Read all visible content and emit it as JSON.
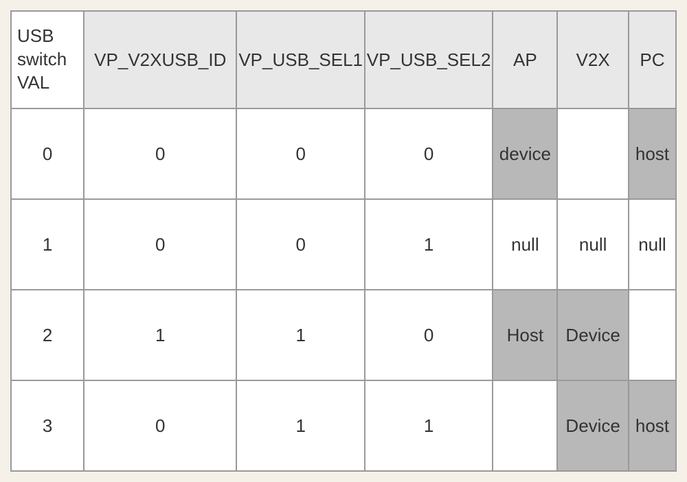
{
  "headers": {
    "col0": "USB switch VAL",
    "col1": "VP_V2XUSB_ID",
    "col2": "VP_USB_SEL1",
    "col3": "VP_USB_SEL2",
    "col4": "AP",
    "col5": "V2X",
    "col6": "PC"
  },
  "rows": [
    {
      "val": "0",
      "id": "0",
      "sel1": "0",
      "sel2": "0",
      "ap": "device",
      "v2x": "",
      "pc": "host",
      "shaded": {
        "ap": true,
        "v2x": false,
        "pc": true
      }
    },
    {
      "val": "1",
      "id": "0",
      "sel1": "0",
      "sel2": "1",
      "ap": "null",
      "v2x": "null",
      "pc": "null",
      "shaded": {
        "ap": false,
        "v2x": false,
        "pc": false
      }
    },
    {
      "val": "2",
      "id": "1",
      "sel1": "1",
      "sel2": "0",
      "ap": "Host",
      "v2x": "Device",
      "pc": "",
      "shaded": {
        "ap": true,
        "v2x": true,
        "pc": false
      }
    },
    {
      "val": "3",
      "id": "0",
      "sel1": "1",
      "sel2": "1",
      "ap": "",
      "v2x": "Device",
      "pc": "host",
      "shaded": {
        "ap": false,
        "v2x": true,
        "pc": true
      }
    }
  ],
  "chart_data": {
    "type": "table",
    "title": "USB switch VAL configuration table",
    "columns": [
      "USB switch VAL",
      "VP_V2XUSB_ID",
      "VP_USB_SEL1",
      "VP_USB_SEL2",
      "AP",
      "V2X",
      "PC"
    ],
    "data": [
      [
        "0",
        "0",
        "0",
        "0",
        "device",
        "",
        "host"
      ],
      [
        "1",
        "0",
        "0",
        "1",
        "null",
        "null",
        "null"
      ],
      [
        "2",
        "1",
        "1",
        "0",
        "Host",
        "Device",
        ""
      ],
      [
        "3",
        "0",
        "1",
        "1",
        "",
        "Device",
        "host"
      ]
    ]
  }
}
